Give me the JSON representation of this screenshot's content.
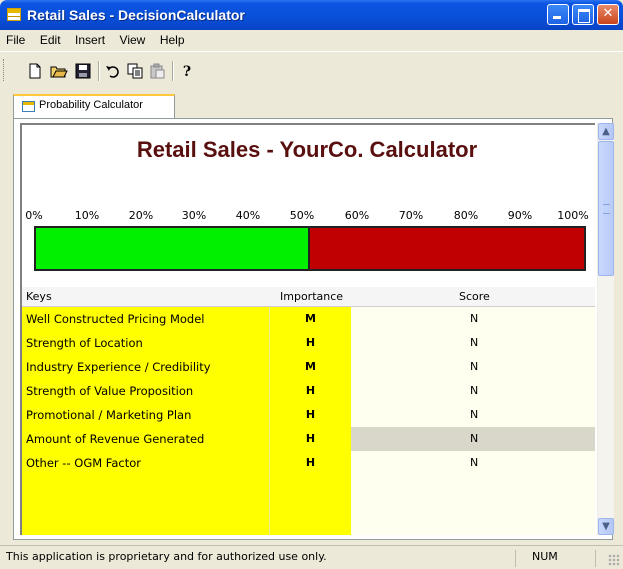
{
  "window": {
    "title": "Retail Sales - DecisionCalculator",
    "controls": [
      "minimize",
      "maximize",
      "close"
    ]
  },
  "menu": [
    "File",
    "Edit",
    "Insert",
    "View",
    "Help"
  ],
  "toolbar": {
    "icons": [
      "new-document-icon",
      "open-folder-icon",
      "save-disk-icon",
      "undo-icon",
      "copy-icon",
      "paste-icon",
      "help-question-icon"
    ]
  },
  "tabs": [
    {
      "label": "Probability Calculator",
      "active": true
    }
  ],
  "calculator": {
    "heading": "Retail Sales - YourCo. Calculator",
    "scale_labels": [
      "0%",
      "10%",
      "20%",
      "30%",
      "40%",
      "50%",
      "60%",
      "70%",
      "80%",
      "90%",
      "100%"
    ],
    "probability_percent": 50,
    "colors": {
      "positive": "#00f000",
      "negative": "#c00000",
      "key_bg": "#ffff00",
      "heading": "#5a0f0f"
    }
  },
  "grid": {
    "columns": [
      "Keys",
      "Importance",
      "Score"
    ],
    "rows": [
      {
        "key": "Well Constructed Pricing Model",
        "importance": "M",
        "score": "N"
      },
      {
        "key": "Strength of Location",
        "importance": "H",
        "score": "N"
      },
      {
        "key": "Industry Experience / Credibility",
        "importance": "M",
        "score": "N"
      },
      {
        "key": "Strength of Value Proposition",
        "importance": "H",
        "score": "N"
      },
      {
        "key": "Promotional / Marketing Plan",
        "importance": "H",
        "score": "N"
      },
      {
        "key": "Amount of Revenue Generated",
        "importance": "H",
        "score": "N",
        "highlighted": true
      },
      {
        "key": "Other -- OGM Factor",
        "importance": "H",
        "score": "N"
      },
      {
        "key": "",
        "importance": "",
        "score": ""
      },
      {
        "key": "",
        "importance": "",
        "score": ""
      },
      {
        "key": "",
        "importance": "",
        "score": ""
      }
    ]
  },
  "status": {
    "message": "This application is proprietary and for authorized use only.",
    "indicator": "NUM"
  }
}
